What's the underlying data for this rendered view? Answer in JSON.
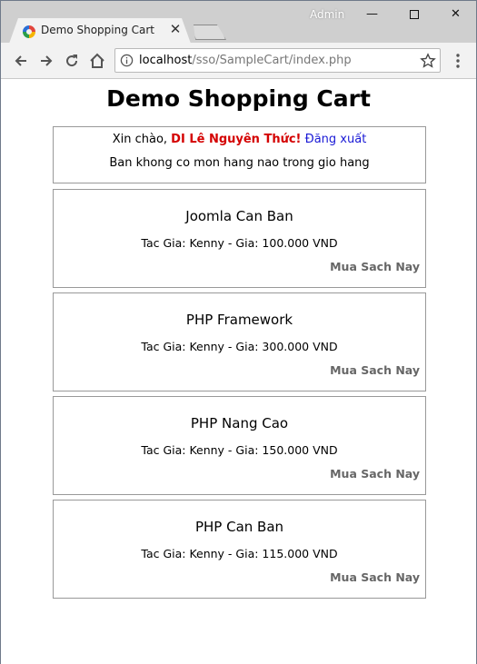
{
  "browser": {
    "tab_title": "Demo Shopping Cart",
    "user_name": "Admin",
    "url_host": "localhost",
    "url_path": "/sso/SampleCart/index.php"
  },
  "page": {
    "title": "Demo Shopping Cart",
    "welcome": {
      "greeting": "Xin chào,",
      "user_name": "DI Lê Nguyên Thức!",
      "logout_label": "Đăng xuất"
    },
    "cart_message": "Ban khong co mon hang nao trong gio hang",
    "products": [
      {
        "name": "Joomla Can Ban",
        "info": "Tac Gia: Kenny - Gia: 100.000 VND",
        "buy_label": "Mua Sach Nay"
      },
      {
        "name": "PHP Framework",
        "info": "Tac Gia: Kenny - Gia: 300.000 VND",
        "buy_label": "Mua Sach Nay"
      },
      {
        "name": "PHP Nang Cao",
        "info": "Tac Gia: Kenny - Gia: 150.000 VND",
        "buy_label": "Mua Sach Nay"
      },
      {
        "name": "PHP Can Ban",
        "info": "Tac Gia: Kenny - Gia: 115.000 VND",
        "buy_label": "Mua Sach Nay"
      }
    ]
  }
}
